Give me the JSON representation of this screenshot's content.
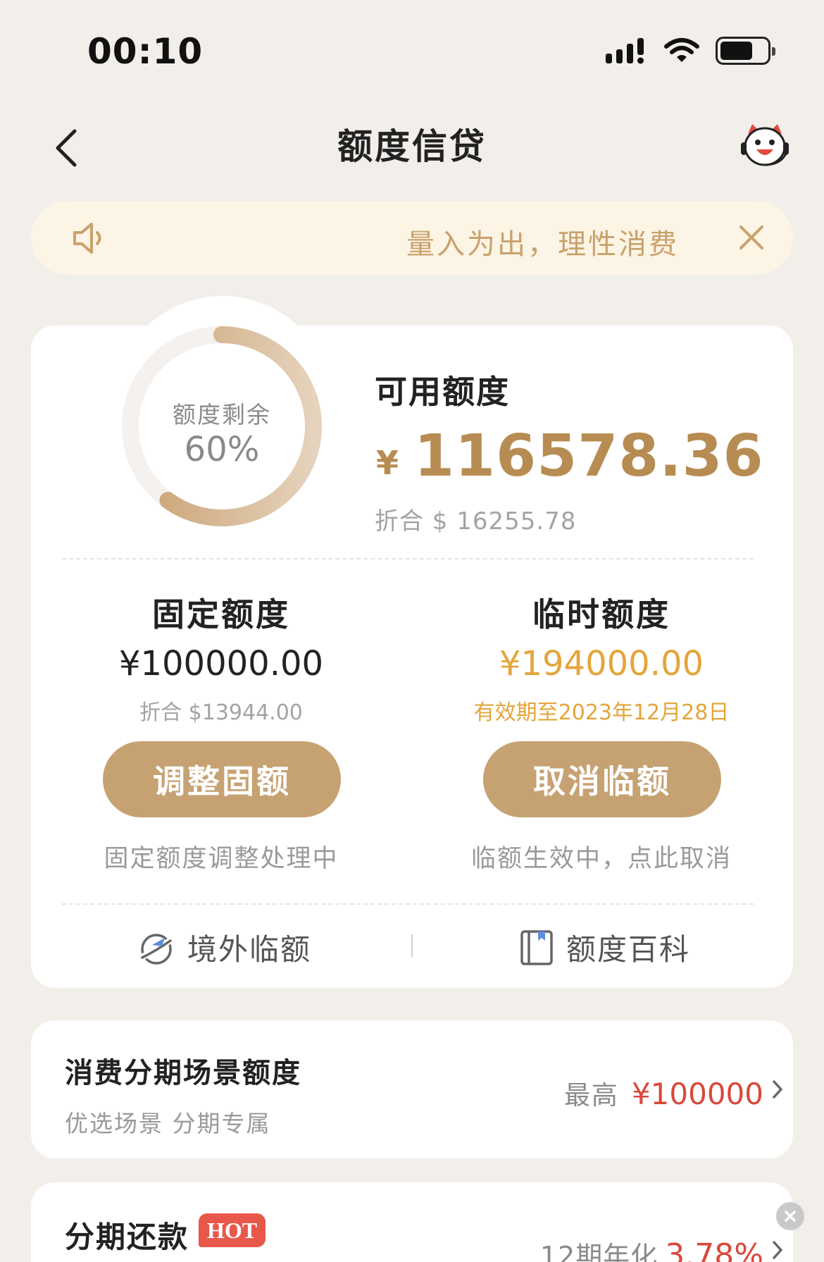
{
  "status_bar": {
    "time": "00:10"
  },
  "nav": {
    "title": "额度信贷"
  },
  "notice": {
    "text": "量入为出，理性消费"
  },
  "ring": {
    "label": "额度剩余",
    "value": "60%",
    "fraction": 0.6
  },
  "available": {
    "title": "可用额度",
    "currency": "¥",
    "amount": "116578.36",
    "usd": "折合 $ 16255.78"
  },
  "fixed": {
    "title": "固定额度",
    "amount": "¥100000.00",
    "usd": "折合 $13944.00",
    "button": "调整固额",
    "note": "固定额度调整处理中"
  },
  "temporary": {
    "title": "临时额度",
    "amount": "¥194000.00",
    "validity": "有效期至2023年12月28日",
    "button": "取消临额",
    "note": "临额生效中，点此取消"
  },
  "links": {
    "overseas": "境外临额",
    "encyclopedia": "额度百科"
  },
  "installment": {
    "title": "消费分期场景额度",
    "subtitle": "优选场景 分期专属",
    "max_label": "最高",
    "max_amount": "¥100000"
  },
  "repay": {
    "title": "分期还款",
    "badge": "HOT",
    "period": "12期年化",
    "rate": "3.78%"
  },
  "colors": {
    "gold": "#b78c52",
    "button": "#c6a273",
    "orange": "#e4a53b",
    "red": "#d9483b"
  }
}
